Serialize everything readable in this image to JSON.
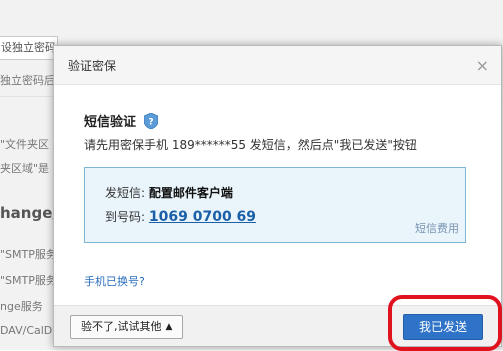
{
  "background": {
    "field_text": "设独立密码",
    "lines": [
      "独立密码后",
      "\"文件夹区",
      "夹区域\"是",
      "hange/",
      "\"SMTP服务",
      "\"SMTP服务",
      "nge服务",
      "DAV/CalD"
    ]
  },
  "dialog": {
    "title": "验证密保",
    "close_label": "×",
    "section_title": "短信验证",
    "shield_icon": "shield-question-icon",
    "instruction": "请先用密保手机 189******55 发短信，然后点\"我已发送\"按钮",
    "sms": {
      "send_label": "发短信:",
      "send_value": "配置邮件客户端",
      "to_label": "到号码:",
      "to_value": "1069 0700 69",
      "fee_label": "短信费用"
    },
    "changed_link": "手机已换号?",
    "footer": {
      "alt_button": "验不了,试试其他",
      "confirm_button": "我已发送"
    }
  },
  "colors": {
    "accent": "#2e73c7",
    "highlight": "#e0121e",
    "infobox_bg": "#eaf5fb"
  }
}
